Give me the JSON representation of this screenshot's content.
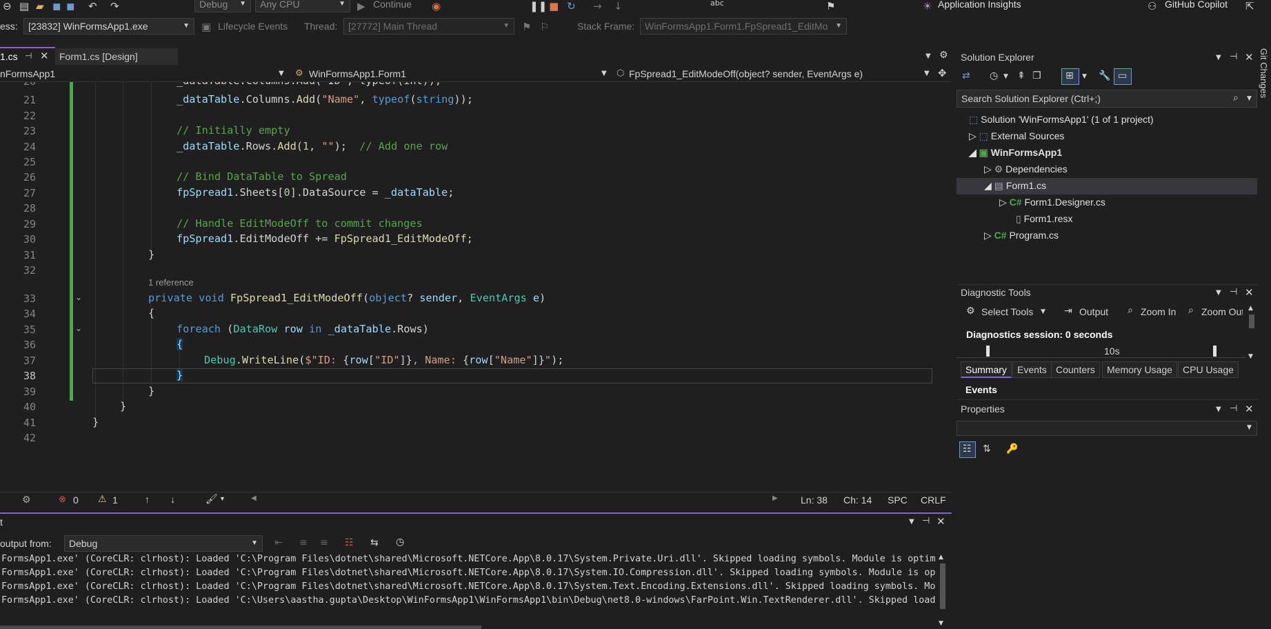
{
  "toolbar": {
    "config": "Debug",
    "platform": "Any CPU",
    "continue": "Continue",
    "app_insights": "Application Insights",
    "copilot": "GitHub Copilot"
  },
  "debugbar": {
    "process_label": "ess:",
    "process_value": "[23832] WinFormsApp1.exe",
    "lifecycle": "Lifecycle Events",
    "thread_label": "Thread:",
    "thread_value": "[27772] Main Thread",
    "stack_label": "Stack Frame:",
    "stack_value": "WinFormsApp1.Form1.FpSpread1_EditMo"
  },
  "tabs": [
    {
      "label": "1.cs",
      "active": true
    },
    {
      "label": "Form1.cs [Design]",
      "active": false
    }
  ],
  "navbar": {
    "project": "nFormsApp1",
    "class": "WinFormsApp1.Form1",
    "member": "FpSpread1_EditModeOff(object? sender, EventArgs e)"
  },
  "editor": {
    "reference_lens": "1 reference",
    "line_numbers": [
      "20",
      "21",
      "22",
      "23",
      "24",
      "25",
      "26",
      "27",
      "28",
      "29",
      "30",
      "31",
      "32",
      "33",
      "34",
      "35",
      "36",
      "37",
      "38",
      "39",
      "40",
      "41",
      "42"
    ],
    "current_line": "38"
  },
  "status": {
    "errors": "0",
    "warnings": "1",
    "line": "Ln: 38",
    "col": "Ch: 14",
    "spc": "SPC",
    "eol": "CRLF"
  },
  "output": {
    "title": "t",
    "show_from_label": "output from:",
    "show_from_value": "Debug",
    "lines": [
      "FormsApp1.exe' (CoreCLR: clrhost): Loaded 'C:\\Program Files\\dotnet\\shared\\Microsoft.NETCore.App\\8.0.17\\System.Private.Uri.dll'. Skipped loading symbols. Module is optimi",
      "FormsApp1.exe' (CoreCLR: clrhost): Loaded 'C:\\Program Files\\dotnet\\shared\\Microsoft.NETCore.App\\8.0.17\\System.IO.Compression.dll'. Skipped loading symbols. Module is opt",
      "FormsApp1.exe' (CoreCLR: clrhost): Loaded 'C:\\Program Files\\dotnet\\shared\\Microsoft.NETCore.App\\8.0.17\\System.Text.Encoding.Extensions.dll'. Skipped loading symbols. Modu",
      "FormsApp1.exe' (CoreCLR: clrhost): Loaded 'C:\\Users\\aastha.gupta\\Desktop\\WinFormsApp1\\WinFormsApp1\\bin\\Debug\\net8.0-windows\\FarPoint.Win.TextRenderer.dll'. Skipped loadi"
    ]
  },
  "solution_explorer": {
    "title": "Solution Explorer",
    "search_placeholder": "Search Solution Explorer (Ctrl+;)",
    "items": [
      {
        "label": "Solution 'WinFormsApp1' (1 of 1 project)",
        "icon": "solution-icon"
      },
      {
        "label": "External Sources",
        "icon": "external-sources-icon"
      },
      {
        "label": "WinFormsApp1",
        "icon": "csharp-project-icon"
      },
      {
        "label": "Dependencies",
        "icon": "dependencies-icon"
      },
      {
        "label": "Form1.cs",
        "icon": "form-icon"
      },
      {
        "label": "Form1.Designer.cs",
        "icon": "csharp-file-icon"
      },
      {
        "label": "Form1.resx",
        "icon": "resx-icon"
      },
      {
        "label": "Program.cs",
        "icon": "csharp-file-icon"
      }
    ]
  },
  "diagnostic_tools": {
    "title": "Diagnostic Tools",
    "select_tools": "Select Tools",
    "output": "Output",
    "zoom_in": "Zoom In",
    "zoom_out": "Zoom Out",
    "session": "Diagnostics session: 0 seconds",
    "timeline_label": "10s",
    "tabs": [
      "Summary",
      "Events",
      "Counters",
      "Memory Usage",
      "CPU Usage"
    ],
    "events_header": "Events"
  },
  "properties": {
    "title": "Properties"
  },
  "side_tab": "Git Changes",
  "colors": {
    "accent": "#8a63d2",
    "change_bar": "#4fa84f",
    "background": "#1f1f1f"
  }
}
